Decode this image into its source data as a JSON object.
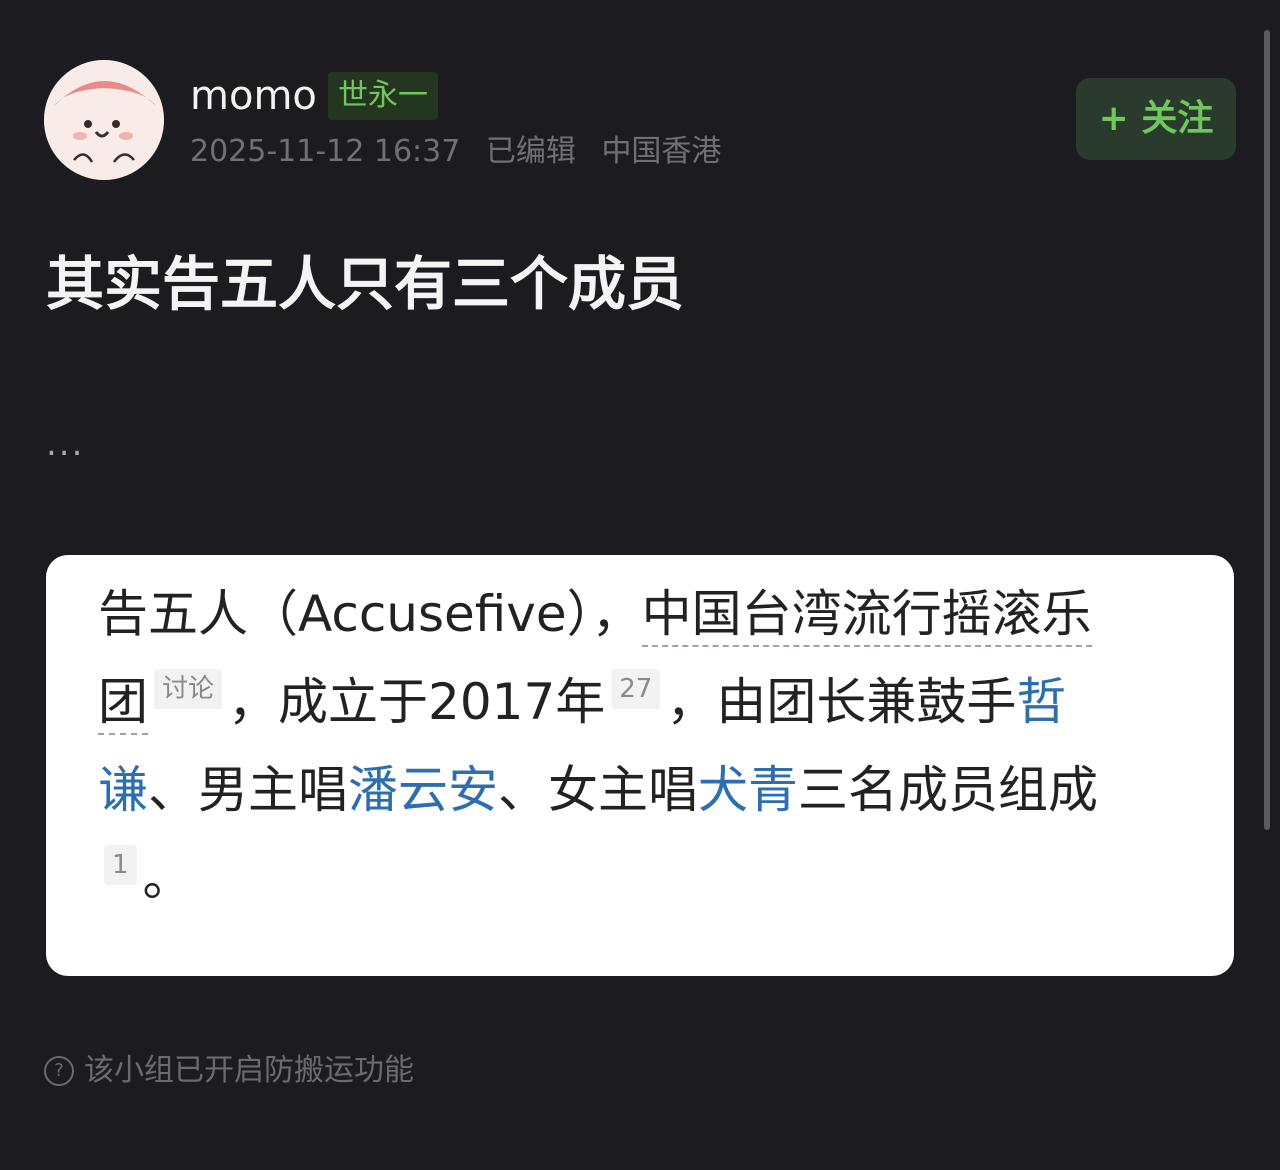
{
  "post": {
    "author": "momo",
    "badge": "世永一",
    "timestamp": "2025-11-12 16:37",
    "edited_label": "已编辑",
    "location": "中国香港",
    "follow_label": "+ 关注",
    "title": "其实告五人只有三个成员",
    "ellipsis": "...",
    "footer_notice": "该小组已开启防搬运功能",
    "help_icon": "?"
  },
  "quote": {
    "line1_a": "告五人（Accusefive），",
    "line1_b": "中国台湾流行摇滚乐",
    "line2_a": "团",
    "ref_discuss": "讨论",
    "line2_b": "，成立于2017年",
    "ref_27": "27",
    "line2_c": "，由团长兼鼓手",
    "line2_link": "哲",
    "line3_link1": "谦",
    "line3_a": "、男主唱",
    "line3_link2": "潘云安",
    "line3_b": "、女主唱",
    "line3_link3": "犬青",
    "line3_c": "三名成员组成",
    "ref_1": "1",
    "line4_a": "。"
  },
  "colors": {
    "background": "#1c1c20",
    "accent_green": "#6fc85c",
    "link_blue": "#2d6fae"
  },
  "icons": {
    "help": "help-circle-icon"
  }
}
